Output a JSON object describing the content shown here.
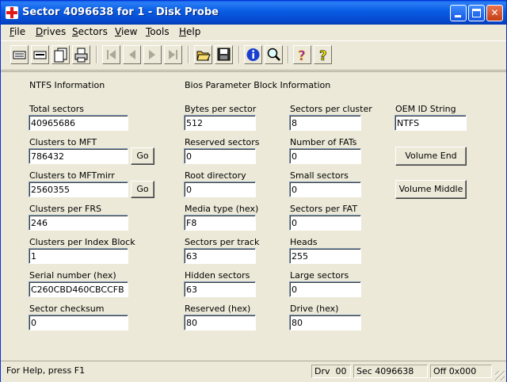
{
  "window": {
    "title": "Sector 4096638 for 1 - Disk Probe"
  },
  "menu": [
    {
      "label": "File",
      "u": "F",
      "rest": "ile"
    },
    {
      "label": "Drives",
      "u": "D",
      "rest": "rives"
    },
    {
      "label": "Sectors",
      "u": "S",
      "rest": "ectors"
    },
    {
      "label": "View",
      "u": "V",
      "rest": "iew"
    },
    {
      "label": "Tools",
      "u": "T",
      "rest": "ools"
    },
    {
      "label": "Help",
      "u": "H",
      "rest": "elp"
    }
  ],
  "toolbar": {
    "icons": [
      "view-bytes-icon",
      "view-partition-icon",
      "view-boot-icon",
      "print-icon",
      "first-sector-icon",
      "previous-sector-icon",
      "next-sector-icon",
      "last-sector-icon",
      "open-folder-icon",
      "save-icon",
      "info-icon",
      "search-icon",
      "help-icon",
      "context-help-icon"
    ]
  },
  "sections": {
    "ntfs_title": "NTFS Information",
    "bpb_title": "Bios Parameter Block Information"
  },
  "ntfs": {
    "total_sectors": {
      "label": "Total sectors",
      "value": "40965686"
    },
    "clusters_to_mft": {
      "label": "Clusters to MFT",
      "value": "786432"
    },
    "clusters_to_mftmirr": {
      "label": "Clusters to MFTmirr",
      "value": "2560355"
    },
    "clusters_per_frs": {
      "label": "Clusters per FRS",
      "value": "246"
    },
    "clusters_per_index_block": {
      "label": "Clusters per Index Block",
      "value": "1"
    },
    "serial_number": {
      "label": "Serial number (hex)",
      "value": "C260CBD460CBCCFB"
    },
    "sector_checksum": {
      "label": "Sector checksum",
      "value": "0"
    },
    "go_label": "Go"
  },
  "bpb": {
    "bytes_per_sector": {
      "label": "Bytes per sector",
      "value": "512"
    },
    "reserved_sectors": {
      "label": "Reserved sectors",
      "value": "0"
    },
    "root_directory": {
      "label": "Root directory",
      "value": "0"
    },
    "media_type": {
      "label": "Media type (hex)",
      "value": "F8"
    },
    "sectors_per_track": {
      "label": "Sectors per track",
      "value": "63"
    },
    "hidden_sectors": {
      "label": "Hidden sectors",
      "value": "63"
    },
    "reserved_hex": {
      "label": "Reserved (hex)",
      "value": "80"
    },
    "sectors_per_cluster": {
      "label": "Sectors per cluster",
      "value": "8"
    },
    "number_of_fats": {
      "label": "Number of FATs",
      "value": "0"
    },
    "small_sectors": {
      "label": "Small sectors",
      "value": "0"
    },
    "sectors_per_fat": {
      "label": "Sectors per FAT",
      "value": "0"
    },
    "heads": {
      "label": "Heads",
      "value": "255"
    },
    "large_sectors": {
      "label": "Large sectors",
      "value": "0"
    },
    "drive_hex": {
      "label": "Drive (hex)",
      "value": "80"
    }
  },
  "oem": {
    "label": "OEM ID String",
    "value": "NTFS",
    "volume_end_label": "Volume End",
    "volume_middle_label": "Volume Middle"
  },
  "status": {
    "help": "For Help, press F1",
    "drive": "Drv  00",
    "sector": "Sec 4096638",
    "offset": "Off 0x000"
  },
  "colors": {
    "titlebar": "#0a5fe6",
    "face": "#ece9d8",
    "info_icon": "#1a3fcf",
    "help_icon": "#a020c0"
  }
}
